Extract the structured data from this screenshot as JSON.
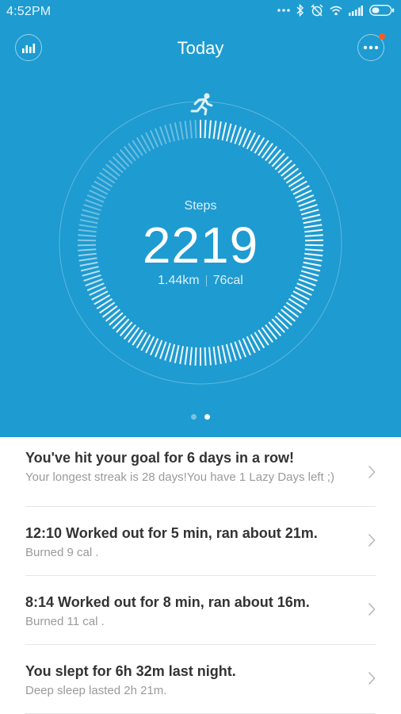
{
  "status_bar": {
    "time": "4:52PM"
  },
  "header": {
    "title": "Today",
    "stats_icon": "bar-chart-icon",
    "more_icon": "more-dots-icon"
  },
  "activity": {
    "icon": "running-icon",
    "steps_label": "Steps",
    "steps_value": "2219",
    "distance": "1.44km",
    "calories": "76cal",
    "goal_progress": 0.77
  },
  "pager": {
    "pages": 2,
    "active_page": 2
  },
  "feed": [
    {
      "title": "You've hit your goal for 6 days in a row!",
      "subtitle": "Your longest streak is 28 days!You have 1 Lazy Days left ;)"
    },
    {
      "title": "12:10  Worked out for 5 min, ran about 21m.",
      "subtitle": "Burned 9 cal ."
    },
    {
      "title": "8:14  Worked out for 8 min, ran about 16m.",
      "subtitle": "Burned 11 cal ."
    },
    {
      "title": "You slept for 6h 32m last night.",
      "subtitle": "Deep sleep lasted 2h 21m."
    }
  ],
  "colors": {
    "hero_background": "#1e9bd1",
    "notification_dot": "#ff5a1f"
  }
}
